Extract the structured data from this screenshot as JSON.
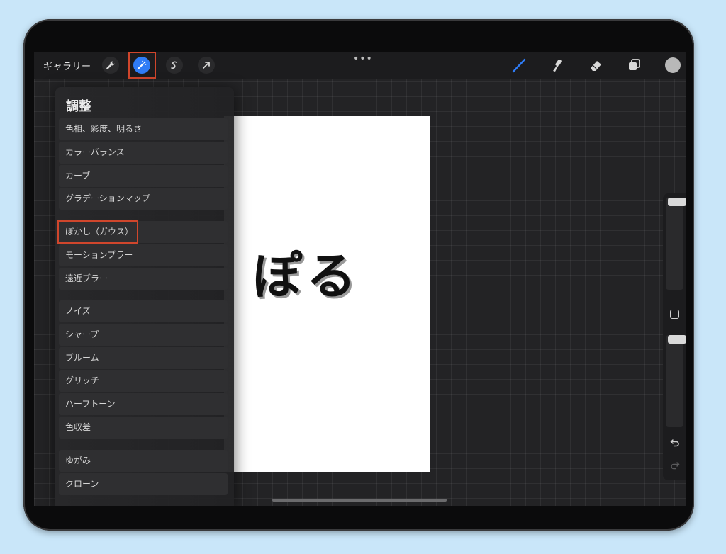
{
  "toolbar": {
    "gallery_label": "ギャラリー",
    "more_label": "•••"
  },
  "canvas": {
    "text": "ぽる"
  },
  "adjustments_menu": {
    "title": "調整",
    "groups": [
      [
        "色相、彩度、明るさ",
        "カラーバランス",
        "カーブ",
        "グラデーションマップ"
      ],
      [
        "ぼかし（ガウス）",
        "モーションブラー",
        "遠近ブラー"
      ],
      [
        "ノイズ",
        "シャープ",
        "ブルーム",
        "グリッチ",
        "ハーフトーン",
        "色収差"
      ],
      [
        "ゆがみ",
        "クローン"
      ]
    ],
    "highlighted_item": "ぼかし（ガウス）"
  },
  "colors": {
    "accent_blue": "#2f7cf6",
    "highlight_red": "#d0462c",
    "current_color": "#b8b8b8"
  },
  "icons": {
    "actions": "wrench-icon",
    "adjustments": "magic-wand-icon",
    "selection": "selection-s-icon",
    "transform": "arrow-cursor-icon",
    "brush": "brush-icon",
    "smudge": "smudge-finger-icon",
    "eraser": "eraser-icon",
    "layers": "layers-icon",
    "modify": "square-icon",
    "undo": "undo-icon",
    "redo": "redo-icon"
  }
}
